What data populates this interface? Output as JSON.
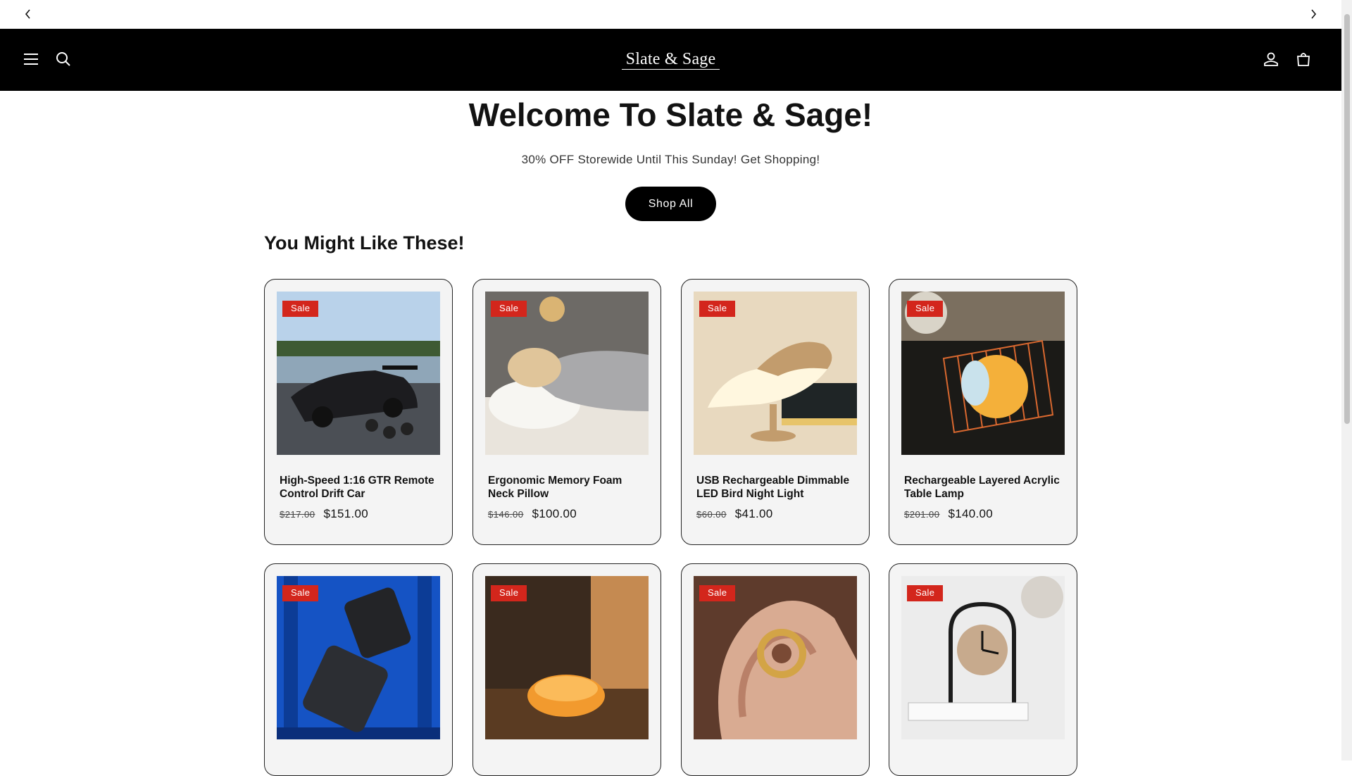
{
  "announcement": {
    "message": "",
    "prev_icon": "chevron-left-icon",
    "next_icon": "chevron-right-icon"
  },
  "header": {
    "logo": "Slate & Sage",
    "icons": [
      "menu-icon",
      "search-icon",
      "account-icon",
      "cart-icon"
    ],
    "background": "#000000"
  },
  "hero": {
    "title": "Welcome To Slate & Sage!",
    "subtitle": "30% OFF Storewide Until This Sunday! Get Shopping!",
    "button_label": "Shop All"
  },
  "section": {
    "title": "You Might Like These!"
  },
  "colors": {
    "sale_badge": "#d3261c",
    "card_bg": "#f4f4f4"
  },
  "products": [
    {
      "badge": "Sale",
      "title": "High-Speed 1:16 GTR Remote Control Drift Car",
      "old_price": "$217.00",
      "price": "$151.00"
    },
    {
      "badge": "Sale",
      "title": "Ergonomic Memory Foam Neck Pillow",
      "old_price": "$146.00",
      "price": "$100.00"
    },
    {
      "badge": "Sale",
      "title": "USB Rechargeable Dimmable LED Bird Night Light",
      "old_price": "$60.00",
      "price": "$41.00"
    },
    {
      "badge": "Sale",
      "title": "Rechargeable Layered Acrylic Table Lamp",
      "old_price": "$201.00",
      "price": "$140.00"
    },
    {
      "badge": "Sale"
    },
    {
      "badge": "Sale"
    },
    {
      "badge": "Sale"
    },
    {
      "badge": "Sale"
    }
  ]
}
